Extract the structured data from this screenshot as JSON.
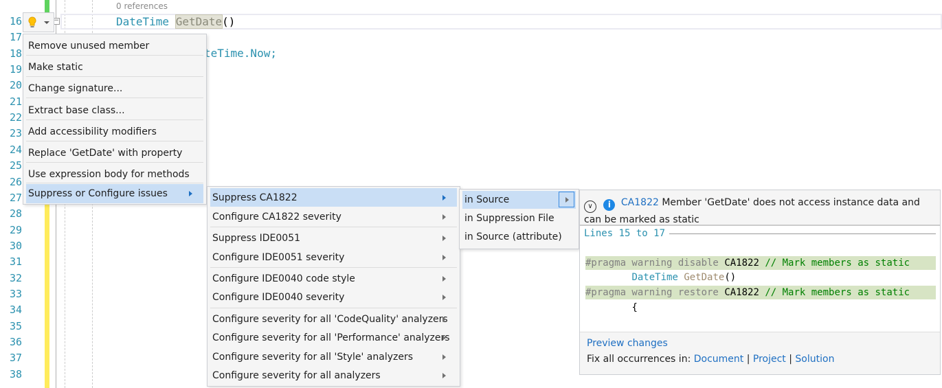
{
  "editor": {
    "line_numbers": [
      "16",
      "17",
      "18",
      "19",
      "20",
      "21",
      "22",
      "23",
      "24",
      "25",
      "26",
      "27",
      "28",
      "29",
      "30",
      "31",
      "32",
      "33",
      "34",
      "35",
      "36",
      "37",
      "38"
    ],
    "codelens": "0 references",
    "line16": {
      "type": "DateTime",
      "method": "GetDate",
      "parens": "()"
    },
    "line18_visible": "teTime.Now;"
  },
  "lightbulb": {
    "icon": "lightbulb-icon",
    "dropdown_icon": "chevron-down-icon"
  },
  "quick_actions_menu": {
    "items": [
      "Remove unused member",
      "Make static",
      "Change signature...",
      "Extract base class...",
      "Add accessibility modifiers",
      "Replace 'GetDate' with property",
      "Use expression body for methods",
      "Suppress or Configure issues"
    ],
    "selected": "Suppress or Configure issues"
  },
  "suppress_menu": {
    "items": [
      "Suppress CA1822",
      "Configure CA1822 severity",
      "Suppress IDE0051",
      "Configure IDE0051 severity",
      "Configure IDE0040 code style",
      "Configure IDE0040 severity",
      "Configure severity for all 'CodeQuality' analyzers",
      "Configure severity for all 'Performance' analyzers",
      "Configure severity for all 'Style' analyzers",
      "Configure severity for all analyzers"
    ],
    "selected": "Suppress CA1822"
  },
  "suppress_target_menu": {
    "items": [
      "in Source",
      "in Suppression File",
      "in Source (attribute)"
    ],
    "selected": "in Source"
  },
  "preview": {
    "rule_id": "CA1822",
    "message": "Member 'GetDate' does not access instance data and can be marked as static",
    "lines_label": "Lines 15 to 17",
    "code": {
      "pragma_disable": "#pragma warning disable",
      "pragma_restore": "#pragma warning restore",
      "rule": "CA1822",
      "comment": "// Mark members as static",
      "type": "DateTime",
      "method": "GetDate",
      "parens": "()",
      "brace": "{"
    },
    "preview_changes": "Preview changes",
    "fix_all_label": "Fix all occurrences in:",
    "fix_all_document": "Document",
    "fix_all_project": "Project",
    "fix_all_solution": "Solution",
    "separator": "|"
  },
  "colors": {
    "accent": "#1e6fc2",
    "selection": "#c9def5",
    "line_number": "#2b91af",
    "type": "#2b91af",
    "comment": "#008000",
    "pragma_bg": "#d7e4c4"
  }
}
